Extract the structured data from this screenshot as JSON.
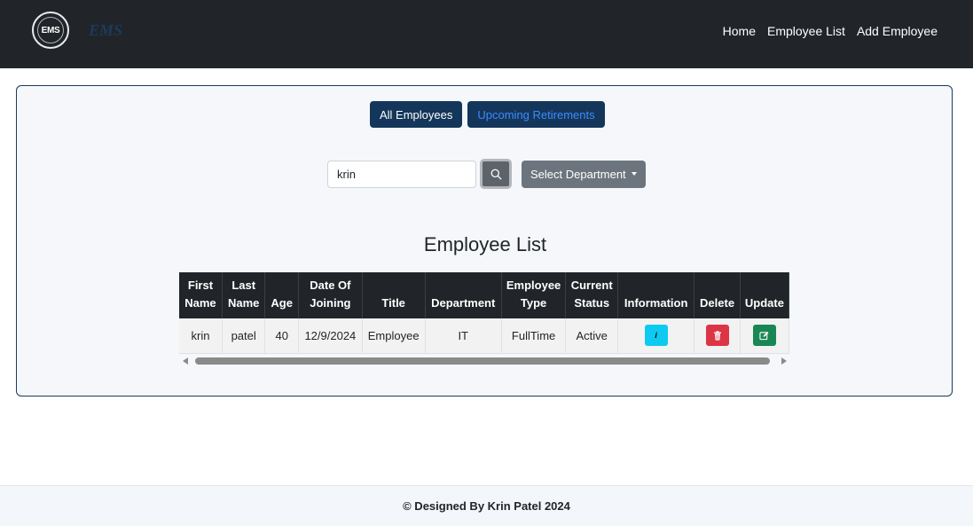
{
  "navbar": {
    "logo_text": "EMS",
    "brand": "EMS",
    "links": [
      "Home",
      "Employee List",
      "Add Employee"
    ]
  },
  "tabs": {
    "all": "All Employees",
    "upcoming": "Upcoming Retirements"
  },
  "search": {
    "value": "krin"
  },
  "department_dropdown": {
    "label": "Select Department"
  },
  "list_title": "Employee List",
  "table": {
    "headers": [
      "First Name",
      "Last Name",
      "Age",
      "Date Of Joining",
      "Title",
      "Department",
      "Employee Type",
      "Current Status",
      "Information",
      "Delete",
      "Update"
    ],
    "rows": [
      {
        "first_name": "krin",
        "last_name": "patel",
        "age": "40",
        "date_of_joining": "12/9/2024",
        "title": "Employee",
        "department": "IT",
        "employee_type": "FullTime",
        "current_status": "Active",
        "info_icon_text": "i"
      }
    ]
  },
  "footer": {
    "prefix": "© Designed By ",
    "author": "Krin Patel",
    "year": " 2024"
  },
  "colors": {
    "navbar_bg": "#212529",
    "primary_dark": "#14365a",
    "info": "#0dcaf0",
    "danger": "#dc3545",
    "success": "#198754"
  }
}
